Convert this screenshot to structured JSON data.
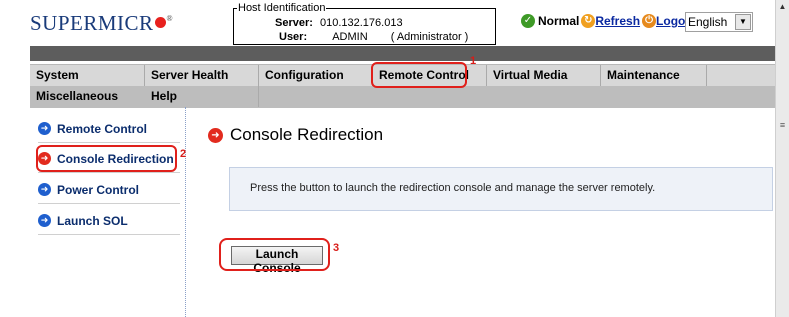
{
  "header": {
    "logo_text": "SUPERMICR",
    "host": {
      "legend": "Host Identification",
      "server_label": "Server:",
      "server_value": "010.132.176.013",
      "user_label": "User:",
      "user_value": "ADMIN",
      "user_role": "( Administrator )"
    },
    "status_text": "Normal",
    "refresh_label": "Refresh",
    "logout_label": "Logout",
    "language": "English"
  },
  "menu": {
    "row1": [
      "System",
      "Server Health",
      "Configuration",
      "Remote Control",
      "Virtual Media",
      "Maintenance"
    ],
    "row2": [
      "Miscellaneous",
      "Help"
    ]
  },
  "sidebar": {
    "items": [
      {
        "label": "Remote Control"
      },
      {
        "label": "Console Redirection"
      },
      {
        "label": "Power Control"
      },
      {
        "label": "Launch SOL"
      }
    ]
  },
  "main": {
    "title": "Console Redirection",
    "description": "Press the button to launch the redirection console and manage the server remotely.",
    "launch_button": "Launch Console"
  },
  "callouts": [
    "1",
    "2",
    "3"
  ],
  "colors": {
    "accent_red": "#e0201b",
    "link_blue": "#0a28a0",
    "menu_gray": "#d8d8d8",
    "dark_bar": "#5d5d5d",
    "sidebar_text": "#0b2d6d"
  },
  "icons": {
    "status": "check-circle-icon",
    "refresh": "refresh-icon",
    "logout": "logout-icon",
    "nav_arrow": "arrow-right-circle-icon"
  }
}
